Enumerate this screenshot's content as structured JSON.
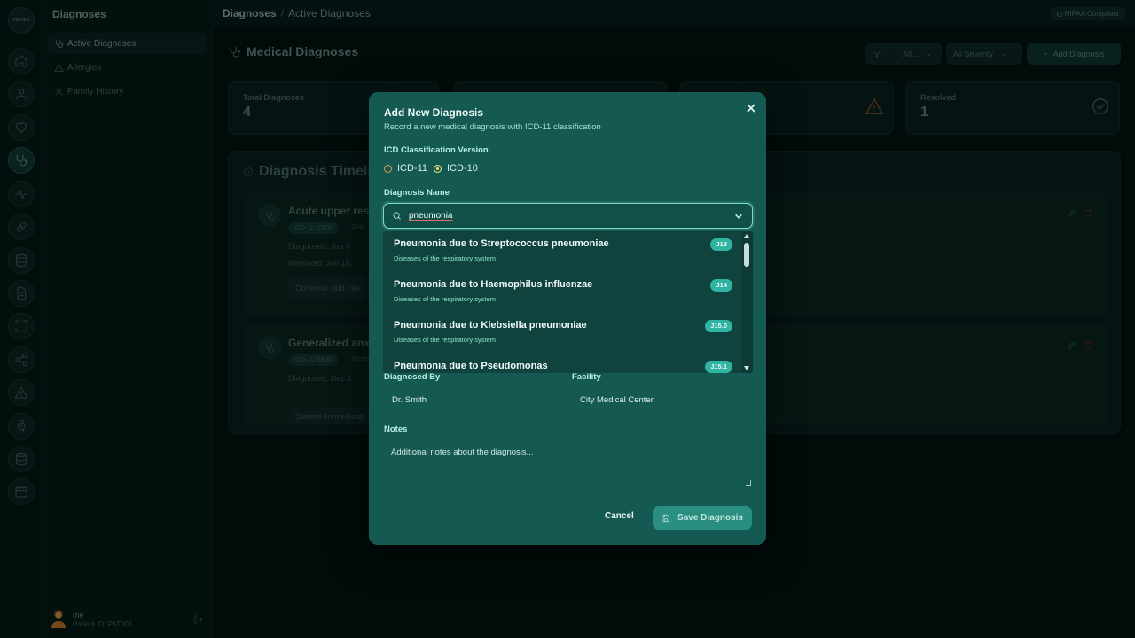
{
  "app": {
    "logo_text": "ZENSIN"
  },
  "sidebar": {
    "title": "Diagnoses",
    "items": [
      {
        "label": "Active Diagnoses",
        "icon": "stethoscope-icon",
        "active": true
      },
      {
        "label": "Allergies",
        "icon": "warning-icon"
      },
      {
        "label": "Family History",
        "icon": "person-icon"
      }
    ],
    "user": {
      "name": "me",
      "patient_id": "Patient ID: PAT001"
    }
  },
  "rail": [
    "home-icon",
    "user-icon",
    "heart-icon",
    "stethoscope-icon",
    "activity-icon",
    "pill-icon",
    "database-icon",
    "document-icon",
    "scan-icon",
    "share-icon",
    "alert-icon",
    "watch-icon",
    "database-icon",
    "calendar-icon"
  ],
  "topbar": {
    "crumb_root": "Diagnoses",
    "crumb_sep": "/",
    "crumb_current": "Active Diagnoses",
    "badge": "HIPAA Compliant"
  },
  "page": {
    "title": "Medical Diagnoses",
    "filter_status": "All...",
    "filter_severity": "All Severity",
    "add_button": "Add Diagnosis",
    "stats": [
      {
        "label": "Total Diagnoses",
        "value": "4"
      },
      {
        "label": "Resolved",
        "value": "1"
      }
    ],
    "timeline_title": "Diagnosis Timeli",
    "cards": [
      {
        "name": "Acute upper res",
        "tag": "ICD-11: CA00",
        "category": "Dise",
        "diagnosed": "Diagnosed: Jan 0",
        "resolved": "Resolved: Jan 15,",
        "note": "Common cold, res"
      },
      {
        "name": "Generalized anx",
        "tag": "ICD-11: 6B00",
        "category": "Menta",
        "diagnosed": "Diagnosed: Dec 1",
        "note": "Started on medicati"
      }
    ]
  },
  "modal": {
    "title": "Add New Diagnosis",
    "subtitle": "Record a new medical diagnosis with ICD-11 classification",
    "icd_label": "ICD Classification Version",
    "icd_options": [
      "ICD-11",
      "ICD-10"
    ],
    "icd_selected": "ICD-10",
    "name_label": "Diagnosis Name",
    "search_value": "pneumonia",
    "results": [
      {
        "name": "Pneumonia due to Streptococcus pneumoniae",
        "category": "Diseases of the respiratory system",
        "code": "J13"
      },
      {
        "name": "Pneumonia due to Haemophilus influenzae",
        "category": "Diseases of the respiratory system",
        "code": "J14"
      },
      {
        "name": "Pneumonia due to Klebsiella pneumoniae",
        "category": "Diseases of the respiratory system",
        "code": "J15.0"
      },
      {
        "name": "Pneumonia due to Pseudomonas",
        "category": "",
        "code": "J15.1"
      }
    ],
    "diagnosed_by_label": "Diagnosed By",
    "diagnosed_by_value": "Dr. Smith",
    "facility_label": "Facility",
    "facility_value": "City Medical Center",
    "notes_label": "Notes",
    "notes_placeholder": "Additional notes about the diagnosis...",
    "cancel_label": "Cancel",
    "save_label": "Save Diagnosis"
  },
  "colors": {
    "modal_bg": "#145a52",
    "accent": "#2fb3a3",
    "code_badge": "#2fb3a3"
  }
}
